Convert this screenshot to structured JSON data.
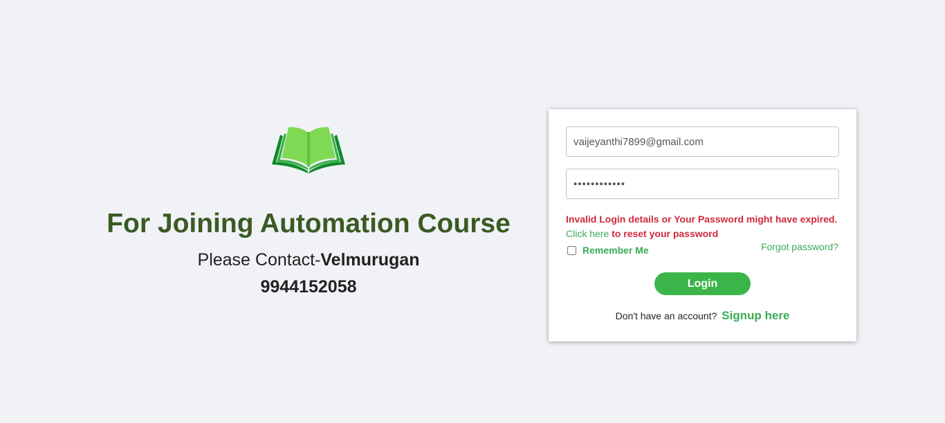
{
  "promo": {
    "title": "For Joining Automation Course",
    "contact_prefix": "Please Contact-",
    "contact_name": "Velmurugan",
    "phone": "9944152058"
  },
  "login_form": {
    "email_value": "vaijeyanthi7899@gmail.com",
    "password_value": "••••••••••••",
    "error_message": "Invalid Login details or Your Password might have expired.",
    "reset_link_label": "Click here",
    "reset_suffix": " to reset your password",
    "remember_label": "Remember Me",
    "remember_checked": false,
    "forgot_label": "Forgot password?",
    "login_label": "Login",
    "signup_prompt": "Don't have an account?",
    "signup_label": "Signup here"
  },
  "icons": {
    "logo": "open-book-icon"
  },
  "colors": {
    "background": "#f0f2f6",
    "title_green": "#3a5a22",
    "accent_green": "#3bb54a",
    "link_green": "#3aaa55",
    "error_red": "#d0283b"
  }
}
